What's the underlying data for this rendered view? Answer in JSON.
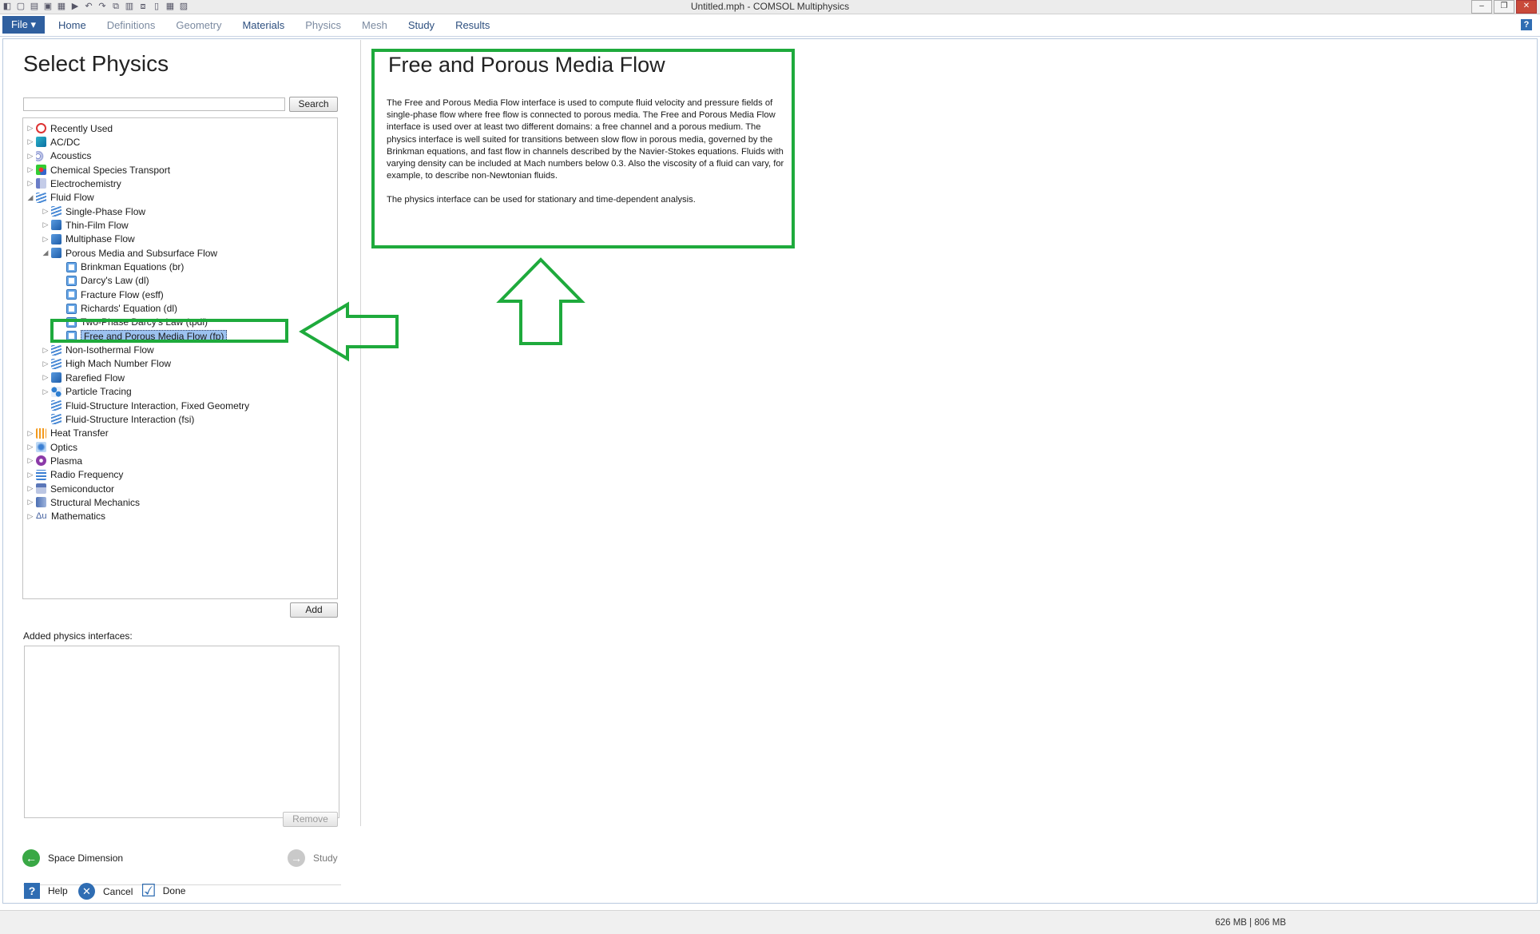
{
  "window": {
    "title": "Untitled.mph - COMSOL Multiphysics",
    "controls": [
      "–",
      "❐",
      "✕"
    ]
  },
  "ribbon": {
    "file_label": "File ▾",
    "tabs": [
      "Home",
      "Definitions",
      "Geometry",
      "Materials",
      "Physics",
      "Mesh",
      "Study",
      "Results"
    ],
    "help_label": "?"
  },
  "panel": {
    "title": "Select Physics",
    "search_button": "Search",
    "add_button": "Add",
    "added_label": "Added physics interfaces:",
    "remove_button": "Remove",
    "back_label": "Space Dimension",
    "next_label": "Study",
    "help_label": "Help",
    "cancel_label": "Cancel",
    "done_label": "Done"
  },
  "tree": [
    {
      "label": "Recently Used",
      "level": 0,
      "expander": "▷",
      "icon": "recent-icon"
    },
    {
      "label": "AC/DC",
      "level": 0,
      "expander": "▷",
      "icon": "acdc-icon"
    },
    {
      "label": "Acoustics",
      "level": 0,
      "expander": "▷",
      "icon": "acoustics-icon"
    },
    {
      "label": "Chemical Species Transport",
      "level": 0,
      "expander": "▷",
      "icon": "chem-icon"
    },
    {
      "label": "Electrochemistry",
      "level": 0,
      "expander": "▷",
      "icon": "electrochem-icon"
    },
    {
      "label": "Fluid Flow",
      "level": 0,
      "expander": "◢",
      "icon": "fluid-flow-icon"
    },
    {
      "label": "Single-Phase Flow",
      "level": 1,
      "expander": "▷",
      "icon": "single-phase-icon"
    },
    {
      "label": "Thin-Film Flow",
      "level": 1,
      "expander": "▷",
      "icon": "thin-film-icon"
    },
    {
      "label": "Multiphase Flow",
      "level": 1,
      "expander": "▷",
      "icon": "multiphase-icon"
    },
    {
      "label": "Porous Media and Subsurface Flow",
      "level": 1,
      "expander": "◢",
      "icon": "porous-media-icon"
    },
    {
      "label": "Brinkman Equations (br)",
      "level": 2,
      "expander": "",
      "icon": "brinkman-icon"
    },
    {
      "label": "Darcy's Law (dl)",
      "level": 2,
      "expander": "",
      "icon": "darcy-icon"
    },
    {
      "label": "Fracture Flow (esff)",
      "level": 2,
      "expander": "",
      "icon": "fracture-icon"
    },
    {
      "label": "Richards' Equation (dl)",
      "level": 2,
      "expander": "",
      "icon": "richards-icon"
    },
    {
      "label": "Two-Phase Darcy's Law (tpdl)",
      "level": 2,
      "expander": "",
      "icon": "two-phase-darcy-icon"
    },
    {
      "label": "Free and Porous Media Flow (fp)",
      "level": 2,
      "expander": "",
      "icon": "free-porous-icon",
      "selected": true
    },
    {
      "label": "Non-Isothermal Flow",
      "level": 1,
      "expander": "▷",
      "icon": "non-isothermal-icon"
    },
    {
      "label": "High Mach Number Flow",
      "level": 1,
      "expander": "▷",
      "icon": "high-mach-icon"
    },
    {
      "label": "Rarefied Flow",
      "level": 1,
      "expander": "▷",
      "icon": "rarefied-icon"
    },
    {
      "label": "Particle Tracing",
      "level": 1,
      "expander": "▷",
      "icon": "particle-icon"
    },
    {
      "label": "Fluid-Structure Interaction, Fixed Geometry",
      "level": 1,
      "expander": "",
      "icon": "fsi-fixed-icon"
    },
    {
      "label": "Fluid-Structure Interaction (fsi)",
      "level": 1,
      "expander": "",
      "icon": "fsi-icon"
    },
    {
      "label": "Heat Transfer",
      "level": 0,
      "expander": "▷",
      "icon": "heat-icon"
    },
    {
      "label": "Optics",
      "level": 0,
      "expander": "▷",
      "icon": "optics-icon"
    },
    {
      "label": "Plasma",
      "level": 0,
      "expander": "▷",
      "icon": "plasma-icon"
    },
    {
      "label": "Radio Frequency",
      "level": 0,
      "expander": "▷",
      "icon": "rf-icon"
    },
    {
      "label": "Semiconductor",
      "level": 0,
      "expander": "▷",
      "icon": "semiconductor-icon"
    },
    {
      "label": "Structural Mechanics",
      "level": 0,
      "expander": "▷",
      "icon": "structural-icon"
    },
    {
      "label": "Mathematics",
      "level": 0,
      "expander": "▷",
      "icon": "math-icon",
      "glyph": "Δu"
    }
  ],
  "description": {
    "title": "Free and Porous Media Flow",
    "paragraph1": "The Free and Porous Media Flow interface is used to compute fluid velocity and pressure fields of single-phase flow where free flow is connected to porous media. The Free and Porous Media Flow interface is used over at least two different domains: a free channel and a porous medium. The physics interface is well suited for transitions between slow flow in porous media, governed by the Brinkman equations, and fast flow in channels described by the Navier-Stokes equations. Fluids with varying density can be included at Mach numbers below 0.3. Also the viscosity of a fluid can vary, for example, to describe non-Newtonian fluids.",
    "paragraph2": "The physics interface can be used for stationary and time-dependent analysis."
  },
  "status": {
    "memory": "626 MB | 806 MB"
  },
  "colors": {
    "annotation": "#1eaa3c",
    "accent": "#2f5f9f",
    "selection": "#9cc2f0"
  }
}
